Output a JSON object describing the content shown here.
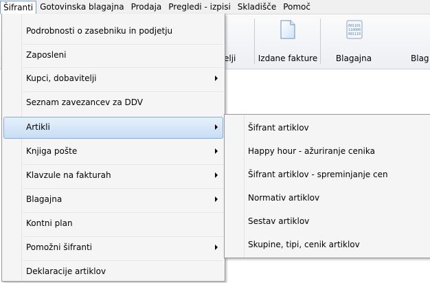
{
  "menubar": {
    "items": [
      {
        "label": "Šifranti"
      },
      {
        "label": "Gotovinska blagajna"
      },
      {
        "label": "Prodaja"
      },
      {
        "label": "Pregledi - izpisi"
      },
      {
        "label": "Skladišče"
      },
      {
        "label": "Pomoč"
      }
    ]
  },
  "toolbar": {
    "buttons": [
      {
        "label": "elji",
        "icon": "partial-icon"
      },
      {
        "label": "Izdane fakture",
        "icon": "document-icon"
      },
      {
        "label": "Blagajna",
        "icon": "receipt-icon",
        "icon_text": "001101\n110000\n001110"
      },
      {
        "label": "Blag",
        "icon": "none"
      }
    ]
  },
  "dropdown": {
    "items": [
      {
        "label": "Podrobnosti o zasebniku in podjetju",
        "submenu": false
      },
      {
        "label": "Zaposleni",
        "submenu": false
      },
      {
        "label": "Kupci, dobavitelji",
        "submenu": true
      },
      {
        "label": "Seznam zavezancev za DDV",
        "submenu": false
      },
      {
        "label": "Artikli",
        "submenu": true,
        "highlighted": true
      },
      {
        "label": "Knjiga pošte",
        "submenu": true
      },
      {
        "label": "Klavzule na fakturah",
        "submenu": true
      },
      {
        "label": "Blagajna",
        "submenu": true
      },
      {
        "label": "Kontni plan",
        "submenu": false
      },
      {
        "label": "Pomožni šifranti",
        "submenu": true
      },
      {
        "label": "Deklaracije artiklov",
        "submenu": false
      }
    ]
  },
  "submenu": {
    "items": [
      {
        "label": "Šifrant artiklov"
      },
      {
        "label": "Happy hour - ažuriranje cenika"
      },
      {
        "label": "Šifrant artiklov - spreminjanje cen"
      },
      {
        "label": "Normativ artiklov"
      },
      {
        "label": "Sestav artiklov"
      },
      {
        "label": "Skupine, tipi, cenik artiklov"
      }
    ]
  },
  "colors": {
    "highlight_border": "#84acdd",
    "highlight_fill": "#c7ddf5",
    "menu_background": "#f5f5f5"
  }
}
